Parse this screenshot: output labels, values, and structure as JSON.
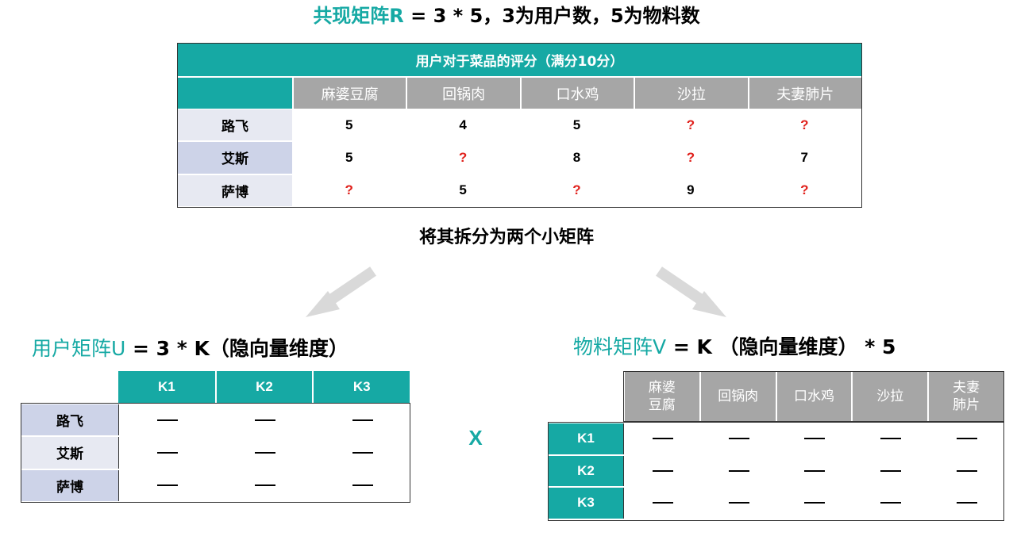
{
  "title": {
    "prefix": "共现矩阵R",
    "rest": " = 3 * 5，3为用户数，5为物料数"
  },
  "main_table": {
    "header": "用户对于菜品的评分（满分10分）",
    "columns": [
      "麻婆豆腐",
      "回锅肉",
      "口水鸡",
      "沙拉",
      "夫妻肺片"
    ],
    "rows": [
      {
        "name": "路飞",
        "values": [
          "5",
          "4",
          "5",
          "?",
          "?"
        ]
      },
      {
        "name": "艾斯",
        "values": [
          "5",
          "?",
          "8",
          "?",
          "7"
        ]
      },
      {
        "name": "萨博",
        "values": [
          "?",
          "5",
          "?",
          "9",
          "?"
        ]
      }
    ]
  },
  "split_text": "将其拆分为两个小矩阵",
  "user_matrix": {
    "label_prefix": "用户矩阵U",
    "label_rest": " = 3 * K（隐向量维度）",
    "columns": [
      "K1",
      "K2",
      "K3"
    ],
    "rows": [
      "路飞",
      "艾斯",
      "萨博"
    ],
    "placeholder": "—"
  },
  "times_symbol": "X",
  "item_matrix": {
    "label_prefix": "物料矩阵V",
    "label_rest": " = K （隐向量维度） * 5",
    "columns": [
      "麻婆\n豆腐",
      "回锅肉",
      "口水鸡",
      "沙拉",
      "夫妻\n肺片"
    ],
    "rows": [
      "K1",
      "K2",
      "K3"
    ],
    "placeholder": "—"
  },
  "colors": {
    "teal": "#16a9a4",
    "gray_header": "#a6a6a6",
    "row_shade_a": "#e7e9f2",
    "row_shade_b": "#cdd3e8",
    "question": "#e0201b",
    "arrow": "#d9d9d9"
  }
}
